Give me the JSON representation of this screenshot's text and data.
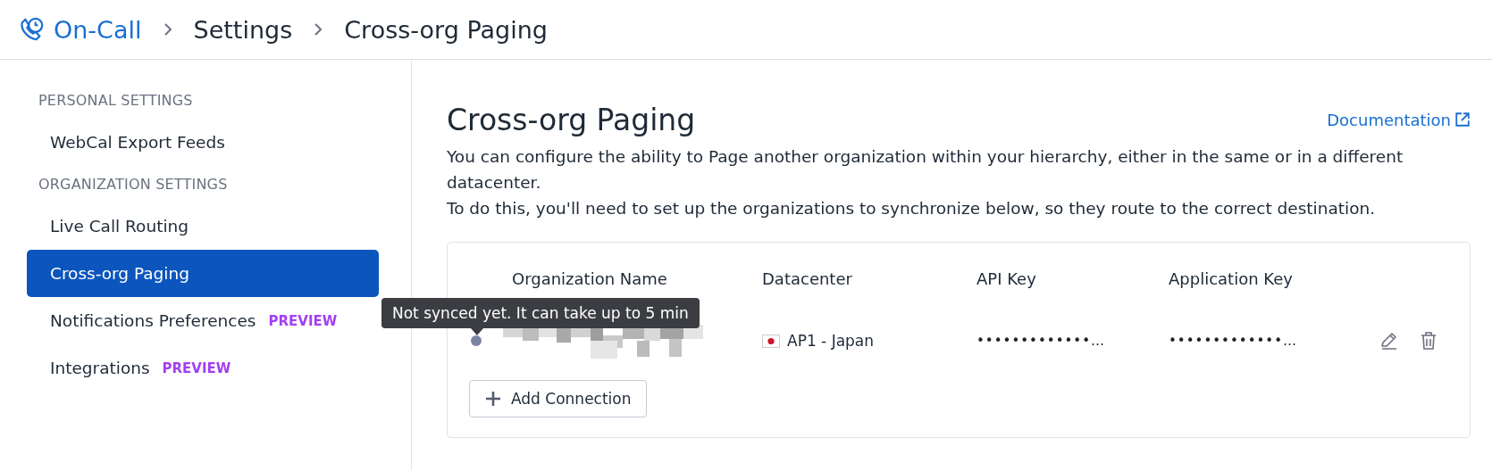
{
  "breadcrumb": [
    {
      "label": "On-Call",
      "kind": "app"
    },
    {
      "label": "Settings",
      "kind": "page"
    },
    {
      "label": "Cross-org Paging",
      "kind": "page"
    }
  ],
  "sidebar": {
    "sections": [
      {
        "heading": "PERSONAL SETTINGS",
        "items": [
          {
            "label": "WebCal Export Feeds",
            "selected": false
          }
        ]
      },
      {
        "heading": "ORGANIZATION SETTINGS",
        "items": [
          {
            "label": "Live Call Routing",
            "selected": false
          },
          {
            "label": "Cross-org Paging",
            "selected": true
          },
          {
            "label": "Notifications Preferences",
            "selected": false,
            "badge": "PREVIEW"
          },
          {
            "label": "Integrations",
            "selected": false,
            "badge": "PREVIEW"
          }
        ]
      }
    ]
  },
  "page": {
    "title": "Cross-org Paging",
    "documentation_link": "Documentation",
    "description": [
      "You can configure the ability to Page another organization within your hierarchy, either in the same or in a different datacenter.",
      "To do this, you'll need to set up the organizations to synchronize below, so they route to the correct destination."
    ]
  },
  "table": {
    "columns": [
      "Organization Name",
      "Datacenter",
      "API Key",
      "Application Key"
    ],
    "rows": [
      {
        "color": "#7c84a3",
        "organization": {
          "kind": "redacted"
        },
        "datacenter": "AP1 - Japan",
        "api_key": "•••••••••••••…",
        "application_key": "•••••••••••••…"
      }
    ]
  },
  "tooltip": "Not synced yet. It can take up to 5 min",
  "add_button": "Add Connection"
}
